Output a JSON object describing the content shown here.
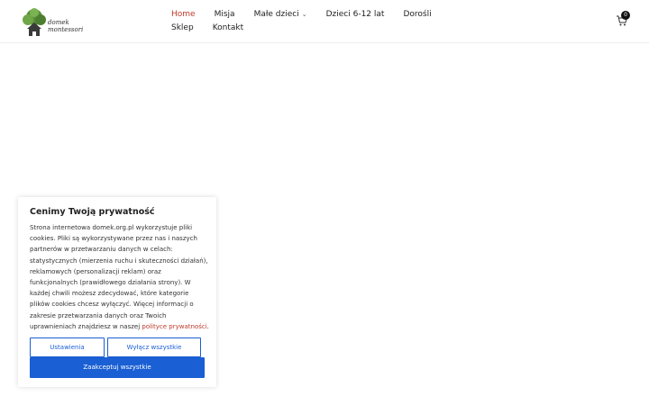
{
  "brand": {
    "logo_text_line1": "domek",
    "logo_text_line2": "montessori"
  },
  "nav": {
    "items": [
      {
        "label": "Home",
        "active": true
      },
      {
        "label": "Misja"
      },
      {
        "label": "Małe dzieci",
        "has_dropdown": true
      },
      {
        "label": "Dzieci 6-12 lat"
      },
      {
        "label": "Dorośli"
      },
      {
        "label": "Sklep"
      },
      {
        "label": "Kontakt"
      }
    ]
  },
  "cart": {
    "count": "0",
    "icon": "cart-icon"
  },
  "cookie": {
    "title": "Cenimy Twoją prywatność",
    "body": "Strona internetowa domek.org.pl wykorzystuje pliki cookies. Pliki są wykorzystywane przez nas i naszych partnerów w przetwarzaniu danych w celach: statystycznych (mierzenia ruchu i skuteczności działań), reklamowych (personalizacji reklam) oraz funkcjonalnych (prawidłowego działania strony). W każdej chwili możesz zdecydować, które kategorie plików cookies chcesz wyłączyć. Więcej informacji o zakresie przetwarzania danych oraz Twoich uprawnieniach znajdziesz w naszej ",
    "link_text": "polityce prywatności",
    "body_end": ".",
    "settings_label": "Ustawienia",
    "reject_label": "Wyłącz wszystkie",
    "accept_label": "Zaakceptuj wszystkie"
  },
  "colors": {
    "accent": "#c0392b",
    "button_blue": "#1a5fd4"
  }
}
